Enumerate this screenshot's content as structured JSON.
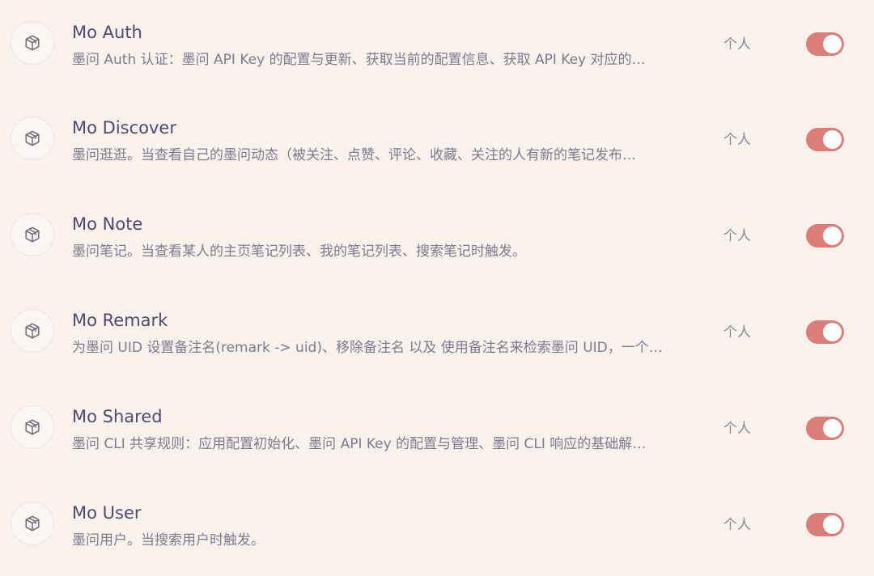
{
  "skills": [
    {
      "icon": "cube-icon",
      "title": "Mo Auth",
      "description": "墨问 Auth 认证：墨问 API Key 的配置与更新、获取当前的配置信息、获取 API Key 对应的…",
      "scope": "个人",
      "enabled": true
    },
    {
      "icon": "cube-icon",
      "title": "Mo Discover",
      "description": "墨问逛逛。当查看自己的墨问动态（被关注、点赞、评论、收藏、关注的人有新的笔记发布…",
      "scope": "个人",
      "enabled": true
    },
    {
      "icon": "cube-icon",
      "title": "Mo Note",
      "description": "墨问笔记。当查看某人的主页笔记列表、我的笔记列表、搜索笔记时触发。",
      "scope": "个人",
      "enabled": true
    },
    {
      "icon": "cube-icon",
      "title": "Mo Remark",
      "description": "为墨问 UID 设置备注名(remark -> uid)、移除备注名 以及 使用备注名来检索墨问 UID，一个…",
      "scope": "个人",
      "enabled": true
    },
    {
      "icon": "cube-icon",
      "title": "Mo Shared",
      "description": "墨问 CLI 共享规则：应用配置初始化、墨问 API Key 的配置与管理、墨问 CLI 响应的基础解…",
      "scope": "个人",
      "enabled": true
    },
    {
      "icon": "cube-icon",
      "title": "Mo User",
      "description": "墨问用户。当搜索用户时触发。",
      "scope": "个人",
      "enabled": true
    }
  ],
  "colors": {
    "background": "#f9f2ec",
    "toggle_on": "#dd7d7a",
    "title": "#4d4a6e",
    "description": "#7e7a8e"
  }
}
